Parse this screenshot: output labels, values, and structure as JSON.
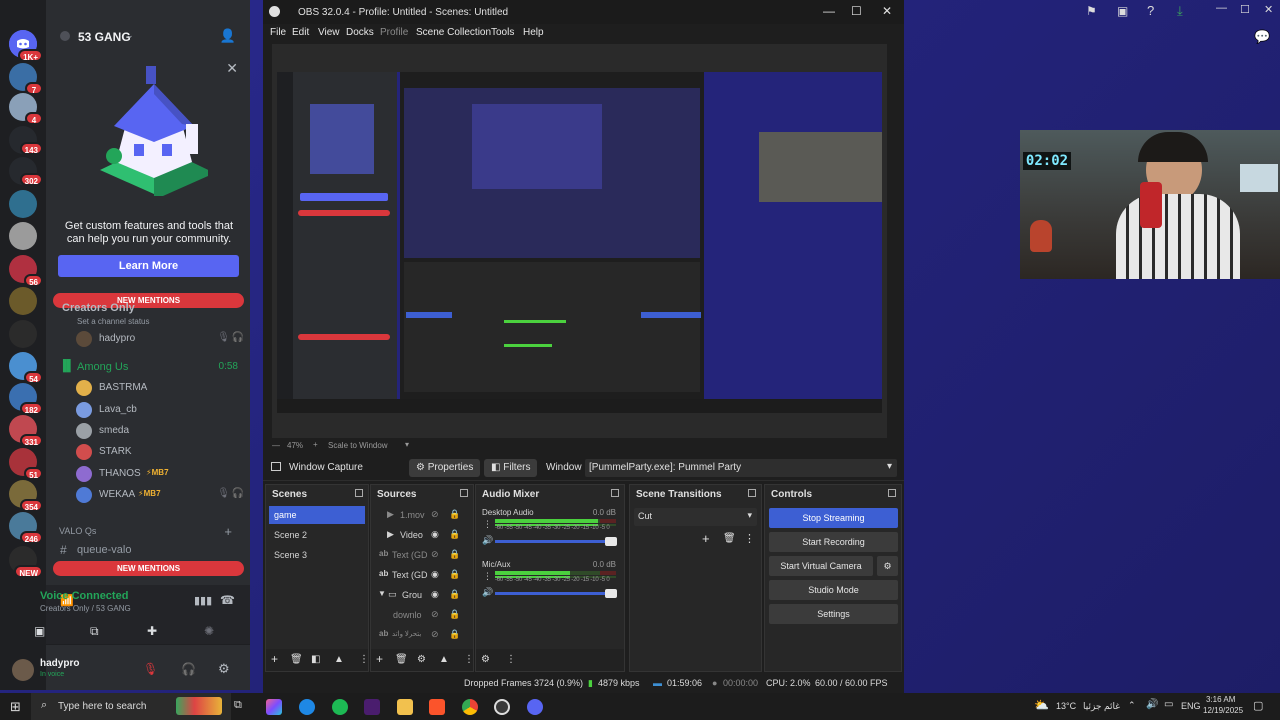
{
  "discord": {
    "home_badge": "1K+",
    "server_name": "53 GANG",
    "promo": {
      "text": "Get custom features and tools that can help you run your community.",
      "button": "Learn More"
    },
    "new_mentions_label": "NEW MENTIONS",
    "channel_creators_only": "Creators Only",
    "channel_status_placeholder": "Set a channel status",
    "voice_user_top": "hadypro",
    "voice_channel": {
      "name": "Among Us",
      "timer": "0:58",
      "users": [
        {
          "name": "BASTRMA",
          "color": "#e2b04a"
        },
        {
          "name": "Lava_cb",
          "color": "#7a9be0"
        },
        {
          "name": "smeda",
          "color": "#9aa0a6"
        },
        {
          "name": "STARK",
          "color": "#d14d4d"
        },
        {
          "name": "THANOS",
          "color": "#8e6bd0"
        },
        {
          "name": "WEKAA",
          "color": "#4f7ad6"
        }
      ],
      "badge_label": "MB7"
    },
    "category_valo": "VALO Qs",
    "channel_queue_valo": "queue-valo",
    "voice_status": "Voice Connected",
    "voice_location": "Creators Only / 53 GANG",
    "username": "hadypro",
    "user_status": "In voice",
    "guild_badges": [
      "7",
      "4",
      "143",
      "302",
      "56",
      "54",
      "182",
      "331",
      "51",
      "354",
      "246",
      "NEW"
    ]
  },
  "obs": {
    "title": "OBS 32.0.4 - Profile: Untitled - Scenes: Untitled",
    "menu": [
      "File",
      "Edit",
      "View",
      "Docks",
      "Profile",
      "Scene Collection",
      "Tools",
      "Help"
    ],
    "zoom": "47%",
    "scale_mode": "Scale to Window",
    "source_name": "Window Capture",
    "properties_label": "Properties",
    "filters_label": "Filters",
    "window_label": "Window",
    "window_value": "[PummelParty.exe]: Pummel Party",
    "scenes": {
      "title": "Scenes",
      "items": [
        "game",
        "Scene 2",
        "Scene 3"
      ]
    },
    "sources": {
      "title": "Sources",
      "items": [
        "1.mov",
        "Video",
        "Text (GD",
        "Text (GD",
        "Grou",
        "downlo",
        "بتحرلا واتد"
      ]
    },
    "audio_mixer": {
      "title": "Audio Mixer",
      "channels": [
        {
          "name": "Desktop Audio",
          "db": "0.0 dB",
          "level": 0.85
        },
        {
          "name": "Mic/Aux",
          "db": "0.0 dB",
          "level": 0.62
        }
      ],
      "scale": "-60 -55 -50 -45 -40 -35 -30 -25 -20 -15 -10 -5 0"
    },
    "transitions": {
      "title": "Scene Transitions",
      "selected": "Cut"
    },
    "controls": {
      "title": "Controls",
      "buttons": [
        "Stop Streaming",
        "Start Recording",
        "Start Virtual Camera",
        "Studio Mode",
        "Settings"
      ]
    },
    "status": {
      "dropped_frames": "Dropped Frames 3724 (0.9%)",
      "bitrate": "4879 kbps",
      "stream_time": "01:59:06",
      "record_time": "00:00:00",
      "cpu": "CPU: 2.0%",
      "fps": "60.00 / 60.00 FPS"
    }
  },
  "webcam": {
    "clock": "02:02"
  },
  "taskbar": {
    "search_placeholder": "Type here to search",
    "weather": "13°C",
    "weather_desc": "غائم جزئيا",
    "language": "ENG",
    "time": "3:16 AM",
    "date": "12/19/2025"
  }
}
